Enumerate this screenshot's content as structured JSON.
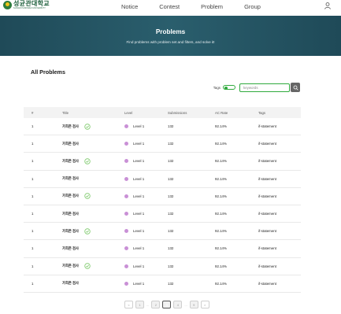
{
  "header": {
    "logo_main": "성균관대학교",
    "logo_sub": "SUNGKYUNKWAN UNIVERSITY",
    "nav": [
      "Notice",
      "Contest",
      "Problem",
      "Group"
    ]
  },
  "banner": {
    "title": "Problems",
    "subtitle": "Find problems with problem set and filters, and solve it!"
  },
  "section": {
    "title": "All Problems"
  },
  "filters": {
    "tags_label": "Tags",
    "tags_toggle_on": true,
    "search_placeholder": "keywords"
  },
  "table": {
    "headers": [
      "#",
      "Title",
      "Level",
      "Submissions",
      "AC Rate",
      "Tags"
    ],
    "rows": [
      {
        "num": "1",
        "title": "가희촌 검사",
        "solved": true,
        "level": "Level 1",
        "submissions": "132",
        "ac_rate": "92.14%",
        "tags": "if-statement"
      },
      {
        "num": "1",
        "title": "가희촌 검사",
        "solved": false,
        "level": "Level 1",
        "submissions": "132",
        "ac_rate": "92.14%",
        "tags": "if-statement"
      },
      {
        "num": "1",
        "title": "가희촌 검사",
        "solved": true,
        "level": "Level 1",
        "submissions": "132",
        "ac_rate": "92.14%",
        "tags": "if-statement"
      },
      {
        "num": "1",
        "title": "가희촌 검사",
        "solved": false,
        "level": "Level 1",
        "submissions": "132",
        "ac_rate": "92.14%",
        "tags": "if-statement"
      },
      {
        "num": "1",
        "title": "가희촌 검사",
        "solved": true,
        "level": "Level 1",
        "submissions": "132",
        "ac_rate": "92.14%",
        "tags": "if-statement"
      },
      {
        "num": "1",
        "title": "가희촌 검사",
        "solved": false,
        "level": "Level 1",
        "submissions": "132",
        "ac_rate": "92.14%",
        "tags": "if-statement"
      },
      {
        "num": "1",
        "title": "가희촌 검사",
        "solved": true,
        "level": "Level 1",
        "submissions": "132",
        "ac_rate": "92.14%",
        "tags": "if-statement"
      },
      {
        "num": "1",
        "title": "가희촌 검사",
        "solved": false,
        "level": "Level 1",
        "submissions": "132",
        "ac_rate": "92.14%",
        "tags": "if-statement"
      },
      {
        "num": "1",
        "title": "가희촌 검사",
        "solved": true,
        "level": "Level 1",
        "submissions": "132",
        "ac_rate": "92.14%",
        "tags": "if-statement"
      },
      {
        "num": "1",
        "title": "가희촌 검사",
        "solved": false,
        "level": "Level 1",
        "submissions": "132",
        "ac_rate": "92.14%",
        "tags": "if-statement"
      }
    ]
  },
  "pagination": {
    "current": "3",
    "items": [
      "<",
      "1",
      "...",
      "2",
      "3",
      "4",
      "...",
      "9",
      ">"
    ]
  },
  "colors": {
    "accent": "#2faa3d",
    "banner": "#24505e",
    "level_dot": "#c990d6",
    "check": "#7cc96a"
  },
  "icons": {
    "user": "user-icon",
    "search": "search-icon",
    "solved": "check-circle-icon"
  }
}
